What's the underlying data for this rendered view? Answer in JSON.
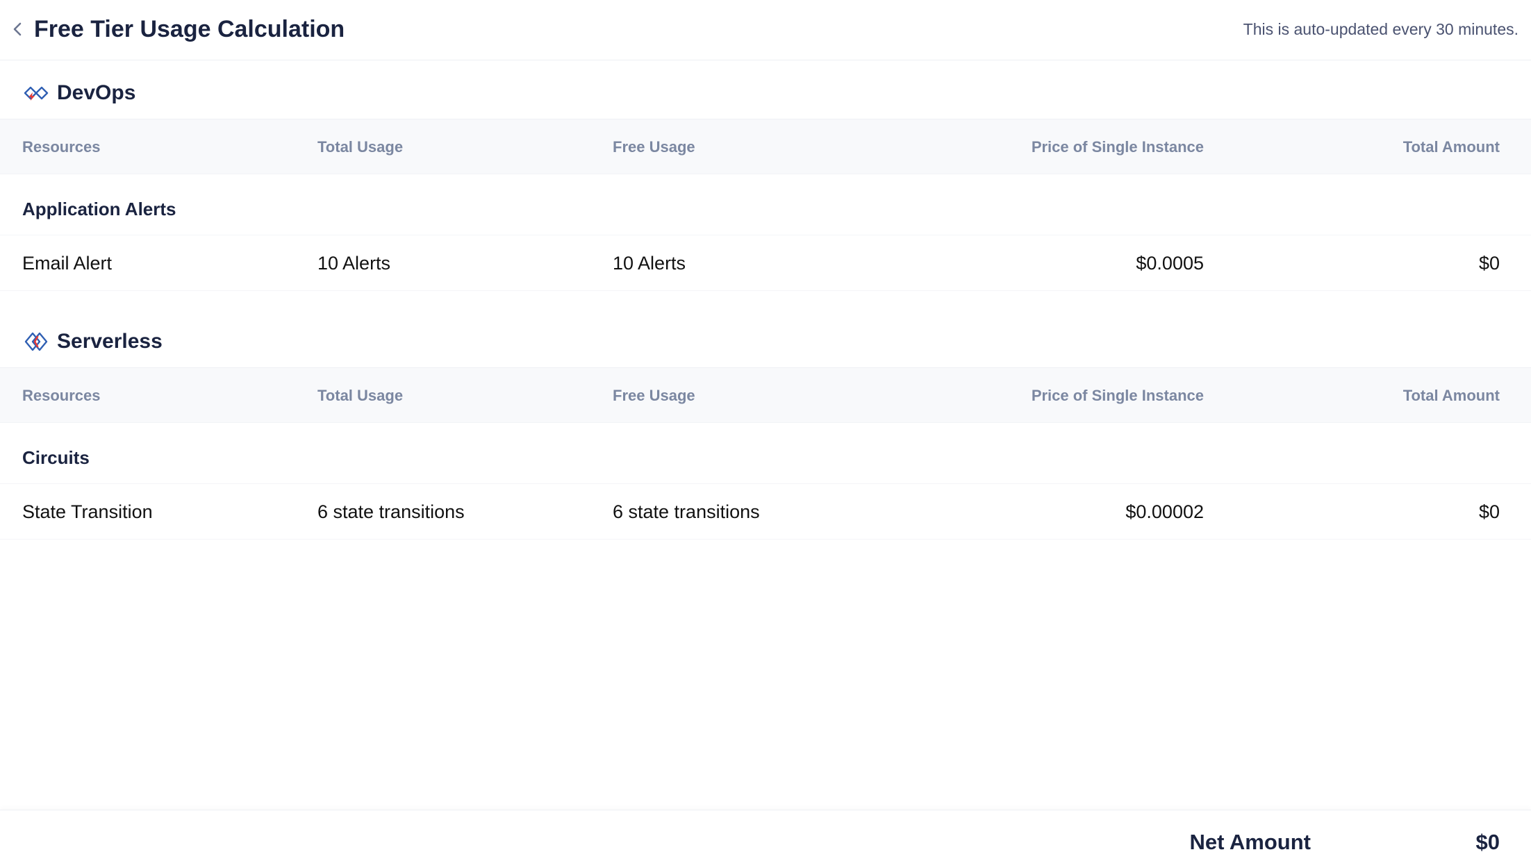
{
  "header": {
    "title": "Free Tier Usage Calculation",
    "auto_update_note": "This is auto-updated every 30 minutes."
  },
  "columns": [
    "Resources",
    "Total Usage",
    "Free Usage",
    "Price of Single Instance",
    "Total Amount"
  ],
  "modules": [
    {
      "name": "DevOps",
      "icon": "devops-icon",
      "groups": [
        {
          "label": "Application Alerts",
          "rows": [
            {
              "resource": "Email Alert",
              "total_usage": "10 Alerts",
              "free_usage": "10 Alerts",
              "price": "$0.0005",
              "amount": "$0"
            }
          ]
        }
      ]
    },
    {
      "name": "Serverless",
      "icon": "serverless-icon",
      "groups": [
        {
          "label": "Circuits",
          "rows": [
            {
              "resource": "State Transition",
              "total_usage": "6 state transitions",
              "free_usage": "6 state transitions",
              "price": "$0.00002",
              "amount": "$0"
            }
          ]
        }
      ]
    }
  ],
  "footer": {
    "net_label": "Net Amount",
    "net_value": "$0"
  },
  "colors": {
    "title": "#1a2340",
    "header_text": "#7b87a1",
    "table_header_bg": "#f8f9fb",
    "icon_red": "#e23a3a",
    "icon_blue": "#2f5fb3"
  }
}
